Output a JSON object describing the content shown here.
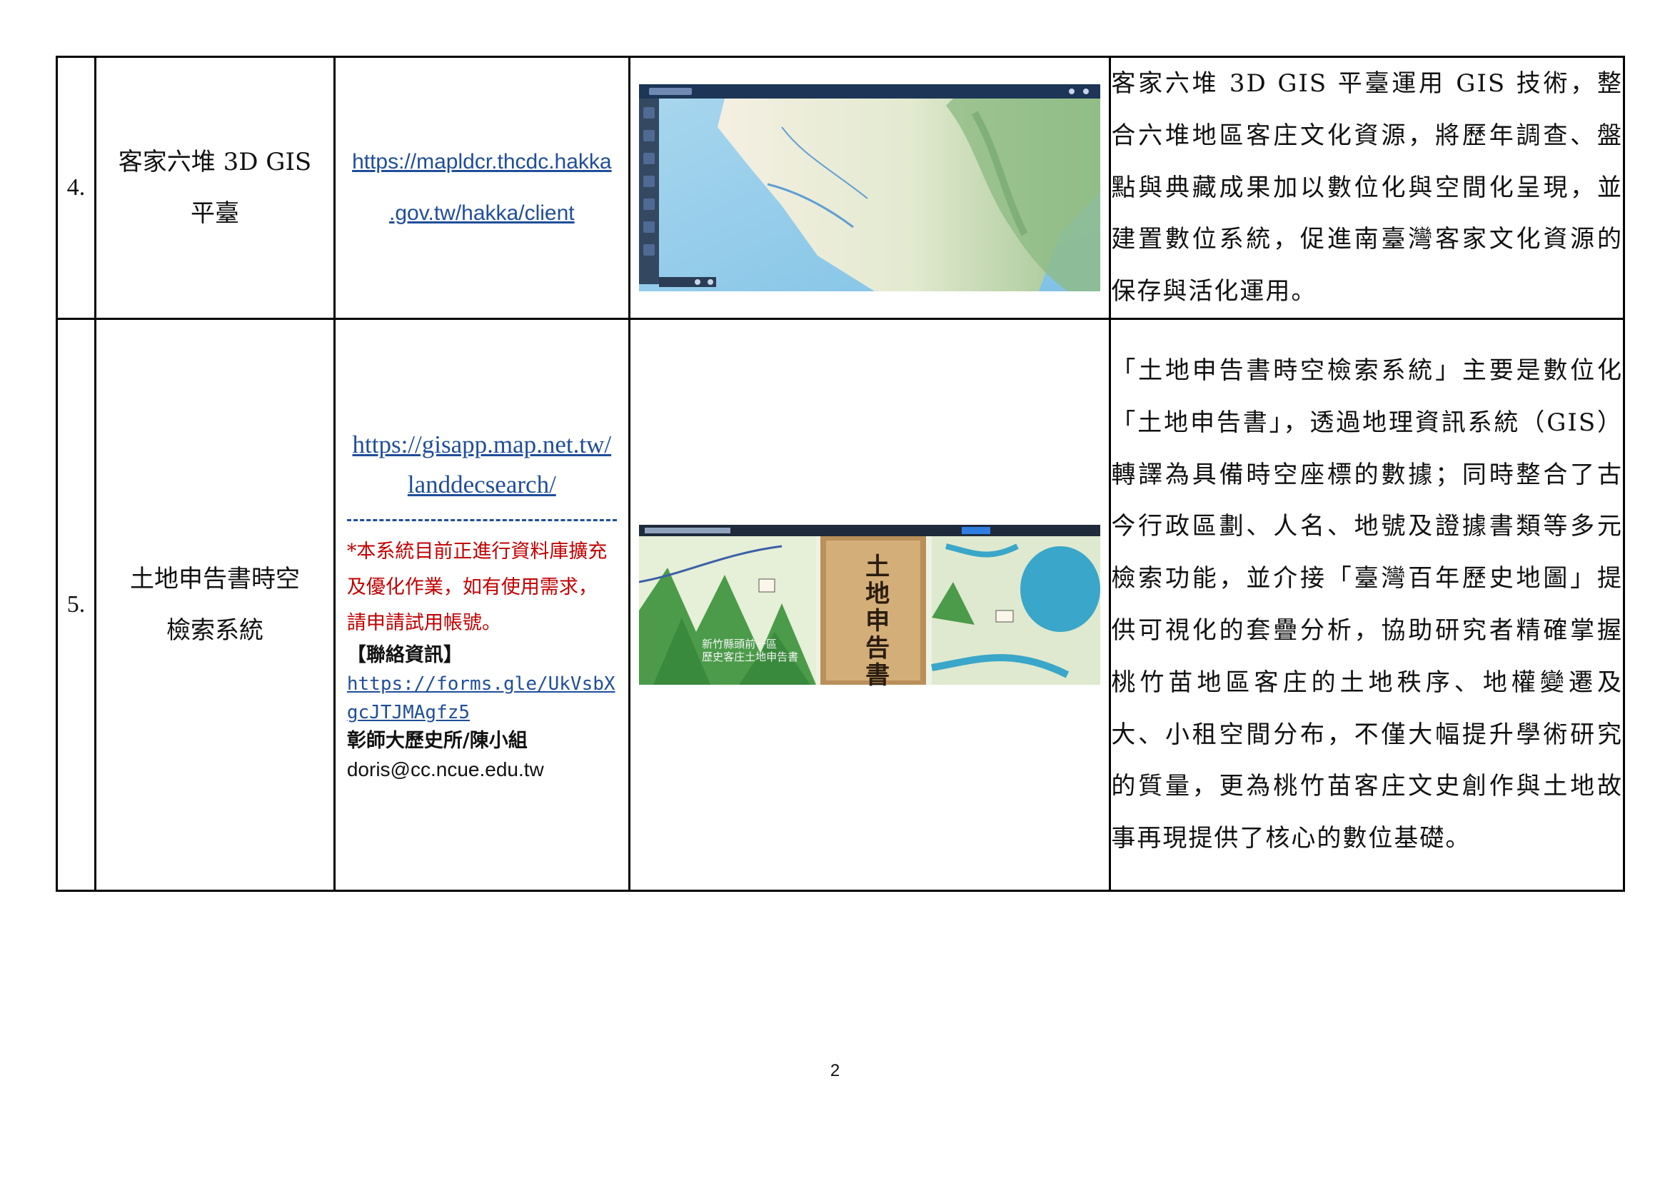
{
  "rows": [
    {
      "number": "4.",
      "name_lines": [
        "客家六堆 3D GIS",
        "平臺"
      ],
      "url_lines": [
        "https://mapldcr.thcdc.hakka",
        ".gov.tw/hakka/client"
      ],
      "description": "客家六堆 3D GIS 平臺運用 GIS 技術，整合六堆地區客庄文化資源，將歷年調查、盤點與典藏成果加以數位化與空間化呈現，並建置數位系統，促進南臺灣客家文化資源的保存與活化運用。"
    },
    {
      "number": "5.",
      "name_lines": [
        "土地申告書時空",
        "檢索系統"
      ],
      "url_lines": [
        "https://gisapp.map.net.tw/",
        "landdecsearch/"
      ],
      "notice": "*本系統目前正進行資料庫擴充及優化作業，如有使用需求，請申請試用帳號。",
      "contact_title": "【聯絡資訊】",
      "contact_link": "https://forms.gle/UkVsbXgcJTJMAgfz5",
      "contact_org": "彰師大歷史所/陳小組",
      "contact_email": "doris@cc.ncue.edu.tw",
      "screenshot_caption_lines": [
        "新竹縣頭前一區",
        "歷史客庄土地申告書"
      ],
      "screenshot_book_title": "土地申告書",
      "description": "「土地申告書時空檢索系統」主要是數位化「土地申告書」，透過地理資訊系統（GIS）轉譯為具備時空座標的數據；同時整合了古今行政區劃、人名、地號及證據書類等多元檢索功能，並介接「臺灣百年歷史地圖」提供可視化的套疊分析，協助研究者精確掌握桃竹苗地區客庄的土地秩序、地權變遷及大、小租空間分布，不僅大幅提升學術研究的質量，更為桃竹苗客庄文史創作與土地故事再現提供了核心的數位基礎。"
    }
  ],
  "page_number": "2",
  "colors": {
    "link": "#1f4e99",
    "notice": "#c00000",
    "border": "#000000"
  }
}
